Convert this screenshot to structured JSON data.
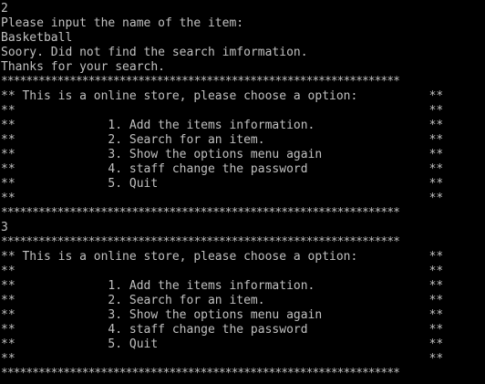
{
  "console": {
    "lines": [
      "2",
      "Please input the name of the item:",
      "Basketball",
      "Soory. Did not find the search imformation.",
      "Thanks for your search.",
      "****************************************************************",
      "** This is a online store, please choose a option:          **",
      "**                                                          **",
      "**             1. Add the items information.                **",
      "**             2. Search for an item.                       **",
      "**             3. Show the options menu again               **",
      "**             4. staff change the password                 **",
      "**             5. Quit                                      **",
      "**                                                          **",
      "****************************************************************",
      "3",
      "****************************************************************",
      "** This is a online store, please choose a option:          **",
      "**                                                          **",
      "**             1. Add the items information.                **",
      "**             2. Search for an item.                       **",
      "**             3. Show the options menu again               **",
      "**             4. staff change the password                 **",
      "**             5. Quit                                      **",
      "**                                                          **",
      "****************************************************************"
    ]
  },
  "colors": {
    "background": "#000000",
    "text": "#c0c0c0"
  }
}
